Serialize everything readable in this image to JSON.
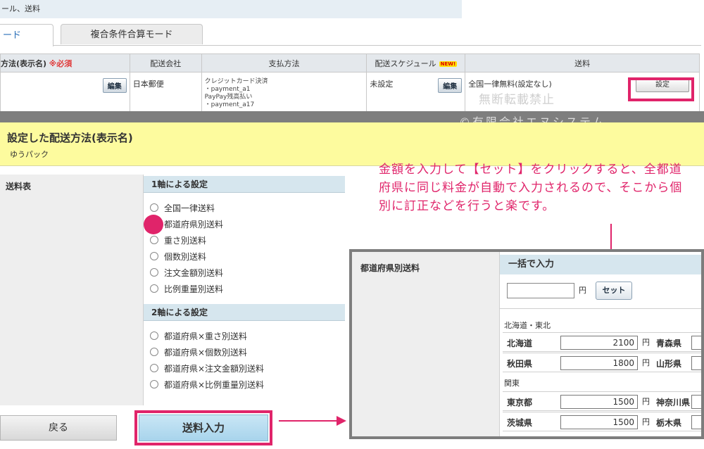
{
  "breadcrumb": "ール、送料",
  "tabs": [
    {
      "label": "ード"
    },
    {
      "label": "複合条件合算モード"
    }
  ],
  "table": {
    "headers": [
      "方法(表示名)",
      "配送会社",
      "支払方法",
      "配送スケジュール",
      "送料"
    ],
    "required_label": "※必須",
    "new_badge": "NEW!",
    "row": {
      "edit_label": "編集",
      "carrier": "日本郵便",
      "payments": [
        "クレジットカード決済",
        "・payment_a1",
        "PayPay残高払い",
        "・payment_a17"
      ],
      "schedule": "未設定",
      "schedule_edit": "編集",
      "shipping": "全国一律無料(設定なし)",
      "set_label": "設定"
    }
  },
  "watermark": {
    "line1": "無断転載禁止",
    "line2": "©有限会社エヌシステム"
  },
  "selected_method": {
    "title": "設定した配送方法(表示名)",
    "value": "ゆうパック"
  },
  "fee_table_label": "送料表",
  "one_axis": {
    "title": "1軸による設定",
    "options": [
      "全国一律送料",
      "都道府県別送料",
      "重さ別送料",
      "個数別送料",
      "注文金額別送料",
      "比例重量別送料"
    ],
    "selected": "都道府県別送料"
  },
  "two_axis": {
    "title": "2軸による設定",
    "options": [
      "都道府県×重さ別送料",
      "都道府県×個数別送料",
      "都道府県×注文金額別送料",
      "都道府県×比例重量別送料"
    ]
  },
  "buttons": {
    "back": "戻る",
    "fee_input": "送料入力"
  },
  "note": "金額を入力して【セット】をクリックすると、全都道府県に同じ料金が自動で入力されるので、そこから個別に訂正などを行うと楽です。",
  "inset": {
    "label": "都道府県別送料",
    "bulk_title": "一括で入力",
    "yen": "円",
    "set_button": "セット",
    "regions": [
      {
        "name": "北海道・東北",
        "rows": [
          {
            "pref": "北海道",
            "value": "2100",
            "pref2": "青森県"
          },
          {
            "pref": "秋田県",
            "value": "1800",
            "pref2": "山形県"
          }
        ]
      },
      {
        "name": "関東",
        "rows": [
          {
            "pref": "東京都",
            "value": "1500",
            "pref2": "神奈川県"
          },
          {
            "pref": "茨城県",
            "value": "1500",
            "pref2": "栃木県"
          }
        ]
      }
    ]
  },
  "colors": {
    "accent": "#e0246a",
    "highlight_band": "#fdfb9e",
    "section_head": "#d6e6ee"
  }
}
